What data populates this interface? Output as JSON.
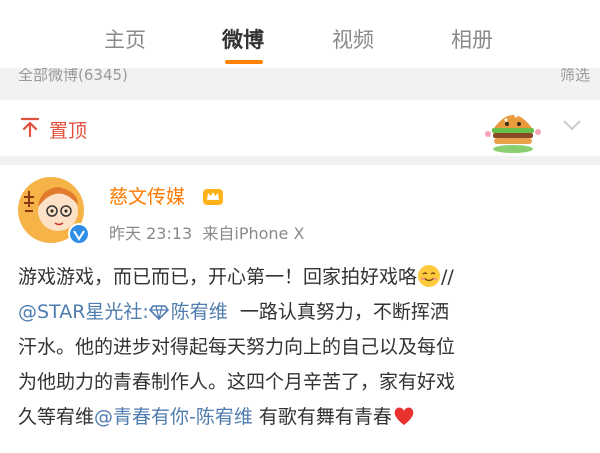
{
  "tabs": [
    {
      "label": "主页",
      "active": false
    },
    {
      "label": "微博",
      "active": true
    },
    {
      "label": "视频",
      "active": false
    },
    {
      "label": "相册",
      "active": false
    }
  ],
  "accent_color": "#ff8200",
  "filter_bar": {
    "left_text": "全部微博(6345)",
    "right_text": "筛选"
  },
  "pinned": {
    "label": "置顶",
    "icon": "pin-icon"
  },
  "post": {
    "author": "慈文传媒",
    "timestamp": "昨天 23:13",
    "source": "来自iPhone X",
    "lines": [
      [
        "游戏游戏，而已而已，开心第一！回家拍好戏咯",
        "//"
      ],
      [
        "@STAR星光社:",
        "陈宥维",
        "一路认真努力，不断挥洒"
      ],
      [
        "汗水。他的进步对得起每天努力向上的自己以及每位"
      ],
      [
        "为他助力的青春制作人。这四个月辛苦了，家有好戏"
      ],
      [
        "久等宥维",
        "@青春有你-陈宥维",
        " 有歌有舞有青春"
      ]
    ],
    "link_color": "#507daf"
  }
}
